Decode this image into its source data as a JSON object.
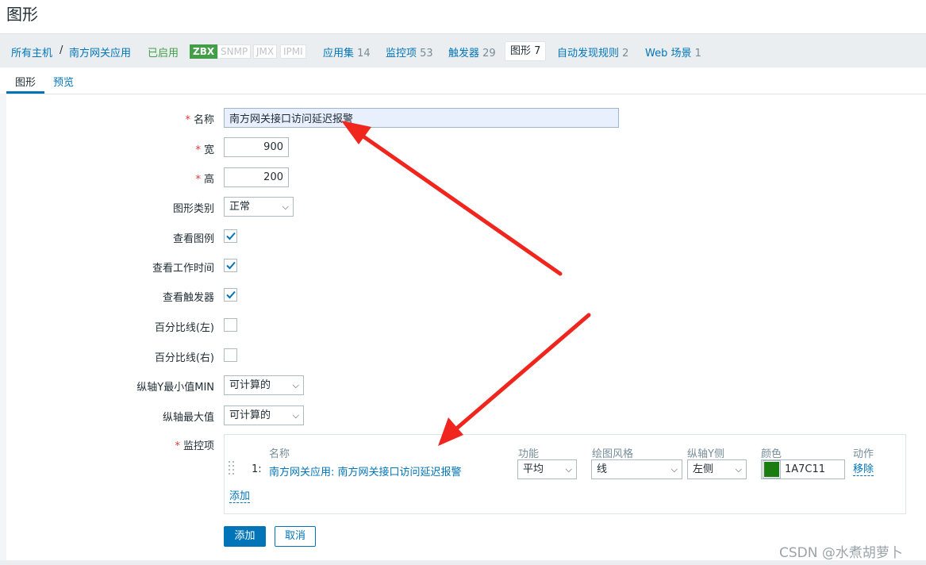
{
  "page_title": "图形",
  "hostnav": {
    "all_hosts": "所有主机",
    "separator": "/",
    "host": "南方网关应用",
    "status": "已启用",
    "badges": [
      "ZBX",
      "SNMP",
      "JMX",
      "IPMI"
    ],
    "applications": {
      "label": "应用集",
      "count": "14"
    },
    "items": {
      "label": "监控项",
      "count": "53"
    },
    "triggers": {
      "label": "触发器",
      "count": "29"
    },
    "graphs": {
      "label": "图形",
      "count": "7"
    },
    "discovery": {
      "label": "自动发现规则",
      "count": "2"
    },
    "web": {
      "label": "Web 场景",
      "count": "1"
    }
  },
  "tabs": [
    "图形",
    "预览"
  ],
  "form": {
    "name_label": "名称",
    "name_value": "南方网关接口访问延迟报警",
    "width_label": "宽",
    "width_value": "900",
    "height_label": "高",
    "height_value": "200",
    "graph_type_label": "图形类别",
    "graph_type_value": "正常",
    "show_legend_label": "查看图例",
    "show_legend": true,
    "show_working_time_label": "查看工作时间",
    "show_working_time": true,
    "show_triggers_label": "查看触发器",
    "show_triggers": true,
    "percentile_left_label": "百分比线(左)",
    "percentile_left": false,
    "percentile_right_label": "百分比线(右)",
    "percentile_right": false,
    "ymin_label": "纵轴Y最小值MIN",
    "ymin_value": "可计算的",
    "ymax_label": "纵轴最大值",
    "ymax_value": "可计算的",
    "items_label": "监控项"
  },
  "items_table": {
    "headers": [
      "名称",
      "功能",
      "绘图风格",
      "纵轴Y侧",
      "颜色",
      "动作"
    ],
    "rows": [
      {
        "num": "1:",
        "name": "南方网关应用: 南方网关接口访问延迟报警",
        "function": "平均",
        "draw_style": "线",
        "y_side": "左侧",
        "color": "1A7C11",
        "action": "移除"
      }
    ],
    "add_link": "添加"
  },
  "buttons": {
    "add": "添加",
    "cancel": "取消"
  },
  "watermark": "CSDN @水煮胡萝卜",
  "colors": {
    "accent": "#0275b8",
    "enabled": "#429e47",
    "required": "#e33734",
    "swatch": "#1A7C11",
    "annotation_arrow": "#f0261e"
  }
}
